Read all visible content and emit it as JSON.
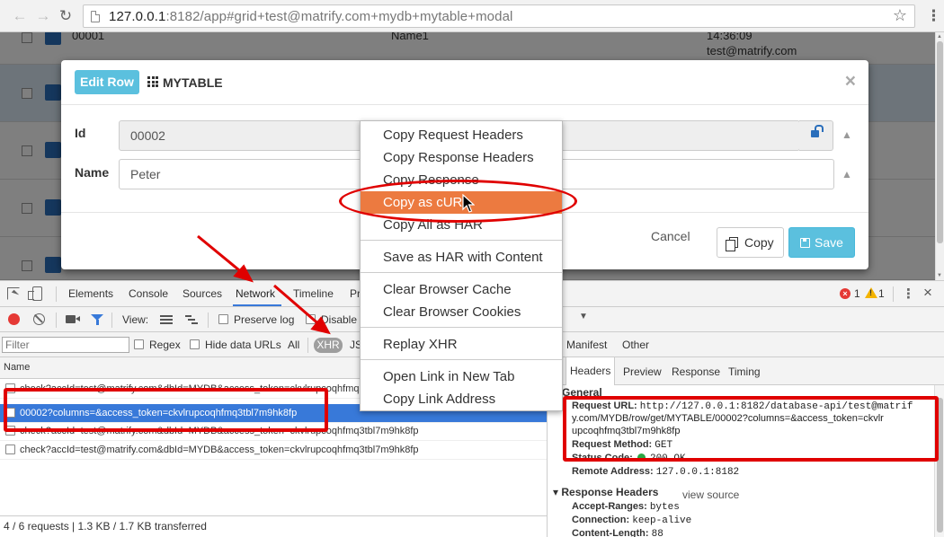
{
  "browser": {
    "url_host": "127.0.0.1",
    "url_rest": ":8182/app#grid+test@matrify.com+mydb+mytable+modal"
  },
  "page": {
    "rows": [
      {
        "id": "00001",
        "name": "Name1",
        "time": "14:36:09",
        "email": "test@matrify.com"
      },
      {
        "id": "",
        "name": "",
        "time": "",
        "email": ""
      }
    ]
  },
  "modal": {
    "badge": "Edit Row",
    "table_name": "MYTABLE",
    "close": "×",
    "fields": [
      {
        "label": "Id",
        "value": "00002"
      },
      {
        "label": "Name",
        "value": "Peter"
      }
    ],
    "buttons": {
      "cancel": "Cancel",
      "copy": "Copy",
      "save": "Save"
    }
  },
  "devtools": {
    "tabs": [
      "Elements",
      "Console",
      "Sources",
      "Network",
      "Timeline",
      "Pr"
    ],
    "errors": "1",
    "warnings": "1",
    "toolbar": {
      "view_label": "View:",
      "preserve_log": "Preserve log",
      "disable_cache": "Disable"
    },
    "filter": {
      "placeholder": "Filter",
      "regex": "Regex",
      "hide_data_urls": "Hide data URLs",
      "all": "All",
      "xhr": "XHR",
      "js": "JS",
      "manifest": "Manifest",
      "other": "Other"
    },
    "requests_header": "Name",
    "requests": [
      {
        "name": "check?accId=test@matrify.com&dbId=MYDB&access_token=ckvlrupcoqhfmq3tbl7m9hk8fp",
        "selected": false
      },
      {
        "name": "00002?columns=&access_token=ckvlrupcoqhfmq3tbl7m9hk8fp",
        "selected": true
      },
      {
        "name": "check?accId=test@matrify.com&dbId=MYDB&access_token=ckvlrupcoqhfmq3tbl7m9hk8fp",
        "selected": false
      },
      {
        "name": "check?accId=test@matrify.com&dbId=MYDB&access_token=ckvlrupcoqhfmq3tbl7m9hk8fp",
        "selected": false
      }
    ],
    "status_bar": "4 / 6 requests  |  1.3 KB / 1.7 KB transferred",
    "detail": {
      "tabs": [
        "Headers",
        "Preview",
        "Response",
        "Timing"
      ],
      "general_title": "General",
      "request_url_label": "Request URL:",
      "request_url_lines": [
        "http://127.0.0.1:8182/database-api/test@matrif",
        "y.com/MYDB/row/get/MYTABLE/00002?columns=&access_token=ckvlr",
        "upcoqhfmq3tbl7m9hk8fp"
      ],
      "request_method_label": "Request Method:",
      "request_method": "GET",
      "status_code_label": "Status Code:",
      "status_code": "200 OK",
      "remote_address_label": "Remote Address:",
      "remote_address": "127.0.0.1:8182",
      "response_headers_title": "Response Headers",
      "view_source": "view source",
      "response_headers": [
        {
          "label": "Accept-Ranges:",
          "value": "bytes"
        },
        {
          "label": "Connection:",
          "value": "keep-alive"
        },
        {
          "label": "Content-Length:",
          "value": "88"
        }
      ]
    }
  },
  "context_menu": {
    "items": [
      "Copy Request Headers",
      "Copy Response Headers",
      "Copy Response",
      "Copy as cURL",
      "Copy All as HAR",
      "Save as HAR with Content",
      "Clear Browser Cache",
      "Clear Browser Cookies",
      "Replay XHR",
      "Open Link in New Tab",
      "Copy Link Address"
    ],
    "highlighted": "Copy as cURL"
  },
  "colors": {
    "annotation": "#e00000",
    "menu_highlight": "#ec7a40",
    "selected_row": "#3879d9",
    "badge": "#5bc0de"
  }
}
